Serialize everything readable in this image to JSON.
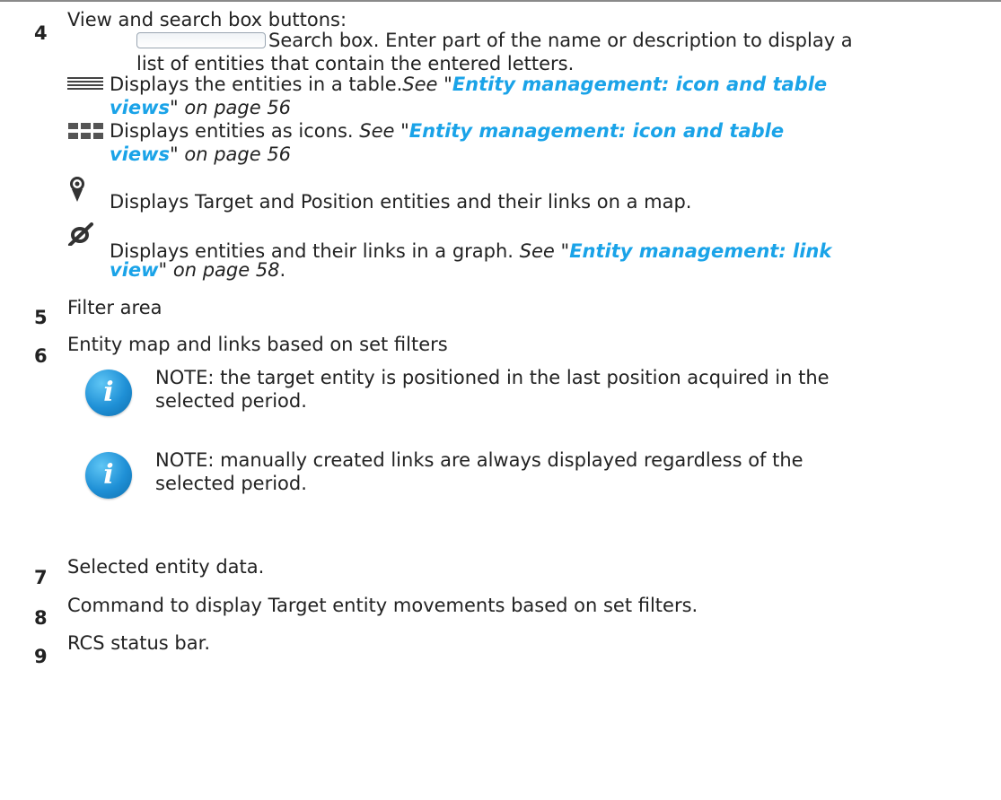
{
  "items": {
    "i4": {
      "number": "4",
      "text": "View and search box buttons:",
      "search": {
        "icon": "search-box-icon",
        "text_line1": "Search box. Enter part of the name or description to display a",
        "text_line2": "list of entities that contain the entered letters."
      },
      "table": {
        "icon": "table-view-icon",
        "text": "Displays the entities in a table.",
        "see": "See \"",
        "link_line1": "Entity management: icon and table",
        "link_line2": "views",
        "suffix": "\" on page 56"
      },
      "icons": {
        "icon": "icon-view-icon",
        "text": "Displays entities as icons. ",
        "see": "See \"",
        "link_line1": "Entity management: icon and table",
        "link_line2": "views",
        "suffix": "\" on page 56"
      },
      "map": {
        "icon": "map-pin-icon",
        "text": "Displays Target and Position entities and their links on a map."
      },
      "graph": {
        "icon": "graph-link-icon",
        "text": "Displays entities and their links in a graph. ",
        "see": "See \"",
        "link_line1": "Entity management: link",
        "link_line2": "view",
        "suffix": "\" on page 58",
        "end": "."
      }
    },
    "i5": {
      "number": "5",
      "text": "Filter area"
    },
    "i6": {
      "number": "6",
      "text": "Entity map and links based on set filters",
      "note1_line1": "NOTE: the target entity is positioned in the last position acquired in the",
      "note1_line2": "selected period.",
      "note2_line1": "NOTE: manually created links are always displayed regardless of the",
      "note2_line2": "selected period.",
      "note_icon": "info-icon",
      "note_glyph": "i"
    },
    "i7": {
      "number": "7",
      "text": "Selected entity data."
    },
    "i8": {
      "number": "8",
      "text": "Command to display Target entity movements based on set filters."
    },
    "i9": {
      "number": "9",
      "text": "RCS status bar."
    }
  },
  "colors": {
    "link": "#1aa3e8",
    "text": "#222222",
    "note_icon": "#1f90d6"
  }
}
